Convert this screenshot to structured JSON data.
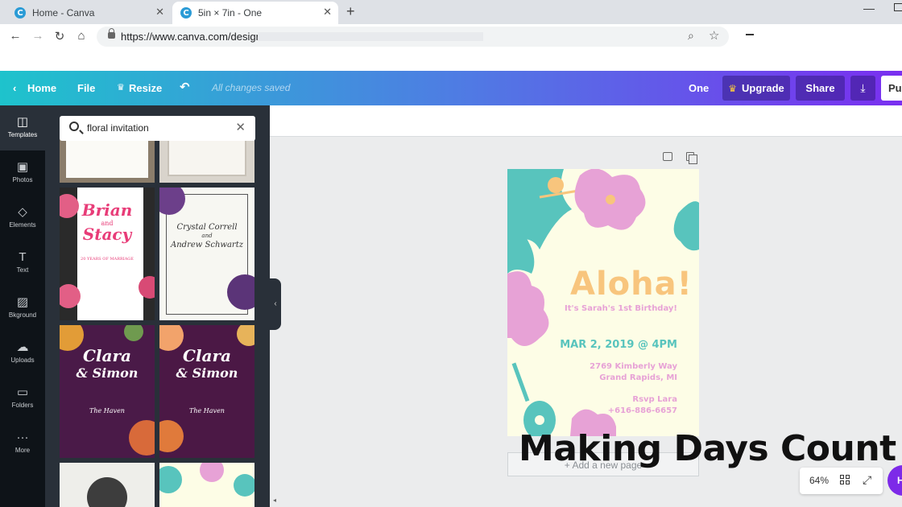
{
  "browser": {
    "tabs": [
      {
        "title": "Home - Canva",
        "active": false
      },
      {
        "title": "5in × 7in - One",
        "active": true
      }
    ],
    "favicon_letter": "C",
    "url": "https://www.canva.com/design/"
  },
  "header": {
    "home_label": "Home",
    "file_label": "File",
    "resize_label": "Resize",
    "save_status": "All changes saved",
    "doc_title": "One",
    "upgrade_label": "Upgrade",
    "share_label": "Share",
    "publish_label": "Publish"
  },
  "rail": {
    "items": [
      {
        "label": "Templates",
        "icon": "templates-icon"
      },
      {
        "label": "Photos",
        "icon": "photos-icon"
      },
      {
        "label": "Elements",
        "icon": "elements-icon"
      },
      {
        "label": "Text",
        "icon": "text-icon"
      },
      {
        "label": "Bkground",
        "icon": "background-icon"
      },
      {
        "label": "Uploads",
        "icon": "uploads-icon"
      },
      {
        "label": "Folders",
        "icon": "folders-icon"
      },
      {
        "label": "More",
        "icon": "more-icon"
      }
    ]
  },
  "search": {
    "value": "floral invitation"
  },
  "templates": {
    "t1": {
      "line1": "Brian",
      "line2": "and",
      "line3": "Stacy",
      "sub": "20 YEARS OF MARRIAGE"
    },
    "t2": {
      "line1": "Crystal Correll",
      "line2": "and",
      "line3": "Andrew Schwartz"
    },
    "t3": {
      "line1": "Clara",
      "line2": "& Simon",
      "sub": "The Haven"
    },
    "t4": {
      "line1": "Clara",
      "line2": "& Simon",
      "sub": "The Haven"
    }
  },
  "design": {
    "headline": "Aloha!",
    "subheadline": "It's Sarah's 1st Birthday!",
    "date": "MAR 2, 2019 @ 4PM",
    "address_line1": "2769 Kimberly Way",
    "address_line2": "Grand Rapids, MI",
    "rsvp_line1": "Rsvp Lara",
    "rsvp_line2": "+616-886-6657",
    "colors": {
      "background": "#fdfde6",
      "teal": "#58c4bd",
      "pink": "#e7a2d6",
      "peach": "#f8c57d"
    }
  },
  "add_page_label": "+ Add a new page",
  "overlay_caption": "Making Days Count",
  "zoom": {
    "level": "64%"
  },
  "help_label": "H"
}
